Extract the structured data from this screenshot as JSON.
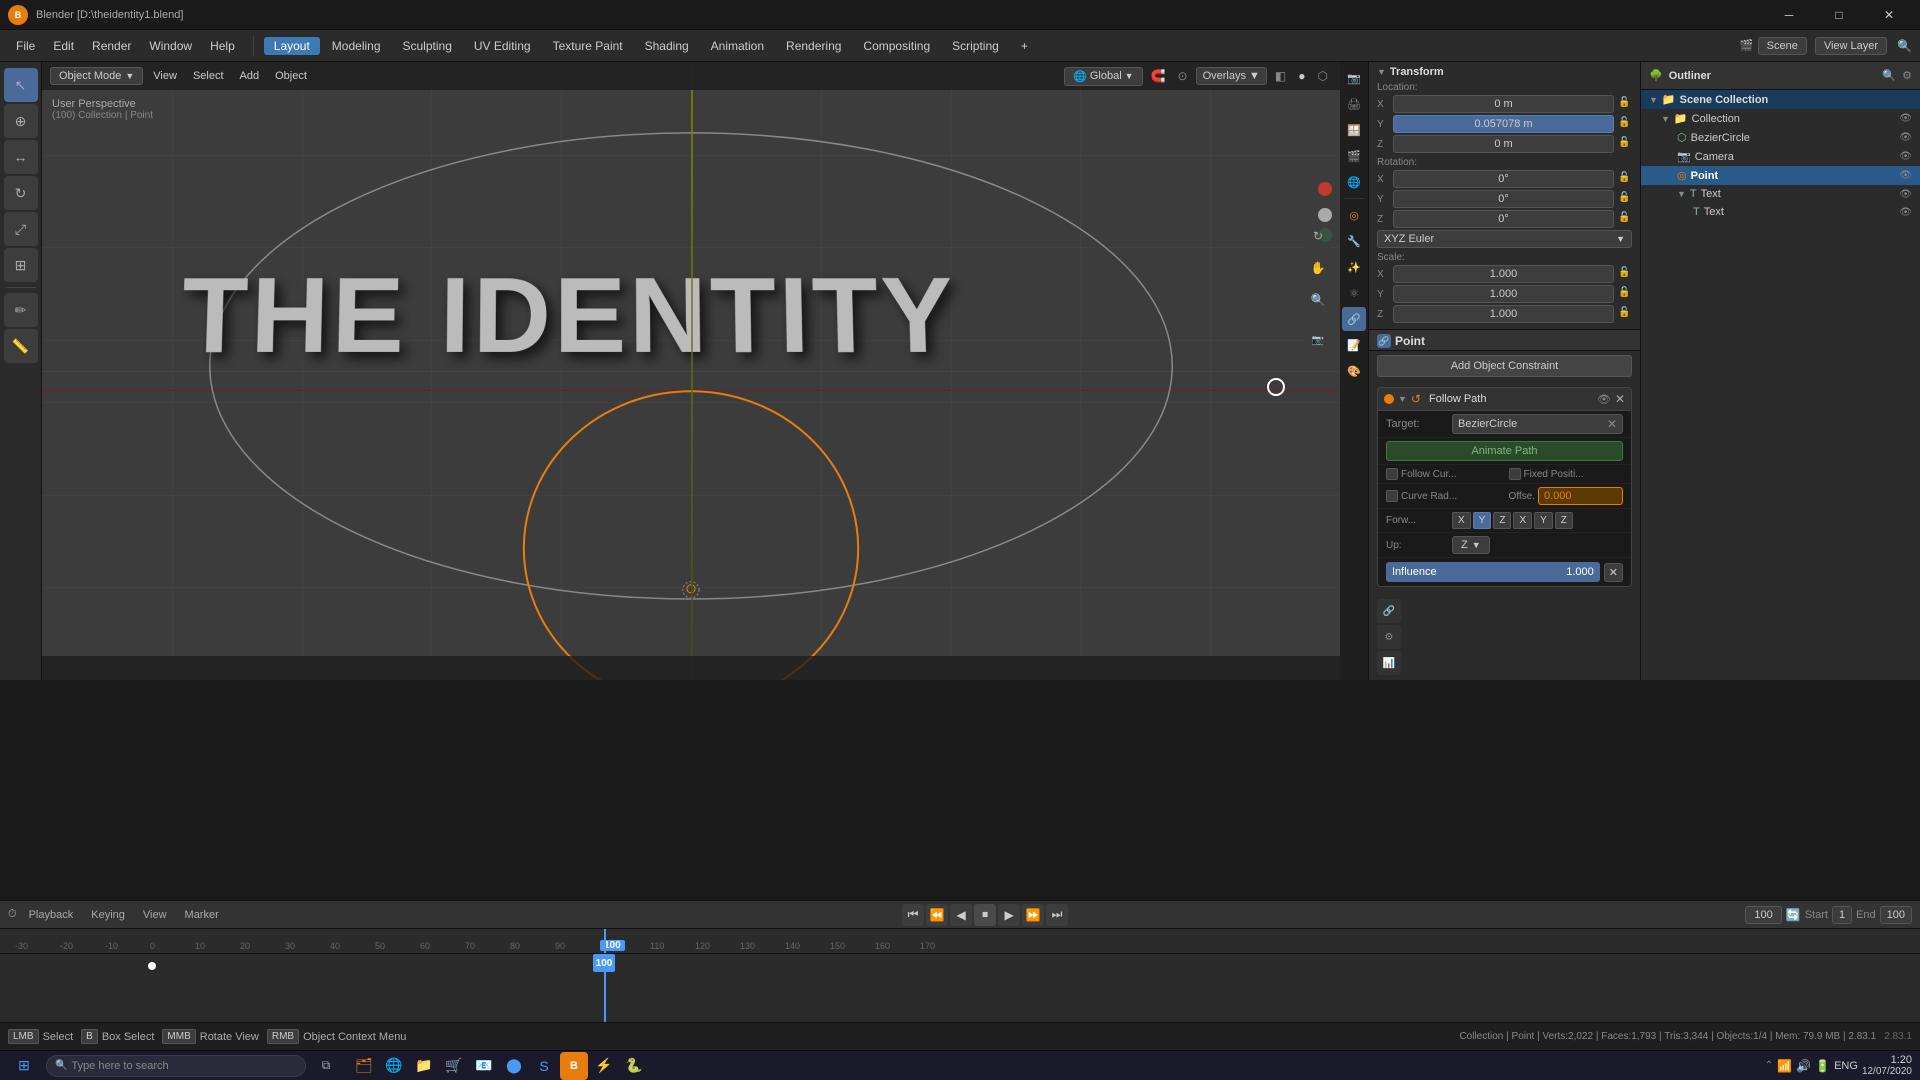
{
  "window": {
    "title": "Blender [D:\\theidentity1.blend]",
    "icon": "B"
  },
  "top_menu": {
    "items": [
      "File",
      "Edit",
      "Render",
      "Window",
      "Help"
    ],
    "workspace_tabs": [
      "Layout",
      "Modeling",
      "Sculpting",
      "UV Editing",
      "Texture Paint",
      "Shading",
      "Animation",
      "Rendering",
      "Compositing",
      "Scripting"
    ],
    "active_tab": "Layout",
    "right_items": [
      "Scene",
      "View Layer"
    ],
    "plus_icon": "+",
    "search_placeholder": "Search..."
  },
  "viewport": {
    "mode": "Object Mode",
    "view": "View",
    "select": "Select",
    "add": "Add",
    "object": "Object",
    "view_label": "User Perspective",
    "collection_label": "(100) Collection | Point",
    "identity_text": "THE IDENTITY",
    "menu_items": [
      "Object Mode",
      "View",
      "Select",
      "Add",
      "Object"
    ]
  },
  "transform": {
    "title": "Transform",
    "location_label": "Location:",
    "location": {
      "x": "0 m",
      "y": "0.057078 m",
      "z": "0 m"
    },
    "rotation_label": "Rotation:",
    "rotation": {
      "x": "0°",
      "y": "0°",
      "z": "0°"
    },
    "rotation_mode": "XYZ Euler",
    "scale_label": "Scale:",
    "scale": {
      "x": "1.000",
      "y": "1.000",
      "z": "1.000"
    }
  },
  "scene_collection": {
    "title": "Scene Collection",
    "items": [
      {
        "label": "Scene Collection",
        "icon": "collection",
        "level": 0
      },
      {
        "label": "Collection",
        "icon": "collection",
        "level": 1
      },
      {
        "label": "BezierCircle",
        "icon": "mesh",
        "level": 2
      },
      {
        "label": "Camera",
        "icon": "camera",
        "level": 2
      },
      {
        "label": "Point",
        "icon": "point",
        "level": 2,
        "active": true
      },
      {
        "label": "Text",
        "icon": "text",
        "level": 2
      },
      {
        "label": "Text",
        "icon": "text",
        "level": 3
      }
    ]
  },
  "object_name": "Point",
  "constraints": {
    "add_button": "Add Object Constraint",
    "follow_path": {
      "title": "Follow Path",
      "target_label": "Target:",
      "target_value": "BezierCircle",
      "animate_path": "Animate Path",
      "follow_curve_label": "Follow Cur...",
      "fixed_position_label": "Fixed Positi...",
      "curve_radius_label": "Curve Rad...",
      "offset_label": "Offse.",
      "offset_value": "0.000",
      "forward_label": "Forw...",
      "forward_axes": [
        "X",
        "Y",
        "Z",
        "X",
        "Y",
        "Z"
      ],
      "forward_active": "Y",
      "up_label": "Up:",
      "up_value": "Z",
      "influence_label": "Influence",
      "influence_value": "1.000"
    }
  },
  "timeline": {
    "playback_label": "Playback",
    "keying_label": "Keying",
    "view_label": "View",
    "marker_label": "Marker",
    "current_frame": "100",
    "start_label": "Start",
    "start_frame": "1",
    "end_label": "End",
    "end_frame": "100",
    "ticks": [
      "-30",
      "-20",
      "-10",
      "0",
      "10",
      "20",
      "30",
      "40",
      "50",
      "60",
      "70",
      "80",
      "90",
      "100",
      "110",
      "120",
      "130",
      "140",
      "150",
      "160",
      "170"
    ]
  },
  "status_bar": {
    "select_label": "Select",
    "box_select_label": "Box Select",
    "rotate_label": "Rotate View",
    "context_menu_label": "Object Context Menu",
    "stats": "Collection | Point | Verts:2,022 | Faces:1,793 | Tris:3,344 | Objects:1/4 | Mem: 79.9 MB | 2.83.1",
    "time": "1:20",
    "date": "12/07/2020"
  },
  "taskbar": {
    "search_placeholder": "Type here to search",
    "time": "1:20",
    "date": "12/07/2020",
    "lang": "ENG"
  }
}
